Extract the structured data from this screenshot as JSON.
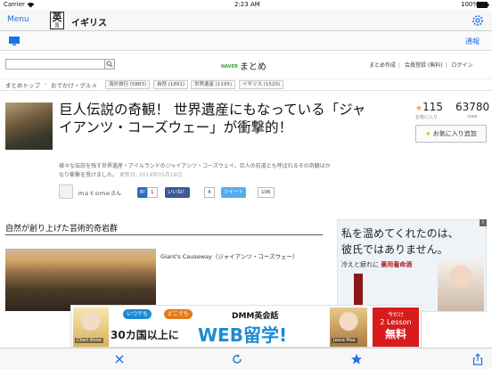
{
  "status_bar": {
    "carrier": "Carrier",
    "wifi_icon": "wifi-icon",
    "time": "2:23 AM",
    "battery": "100%",
    "battery_icon": "battery-icon"
  },
  "nav": {
    "menu_label": "Menu",
    "dict_big": "英",
    "dict_small": "国",
    "title": "イギリス",
    "settings_icon": "gear-icon"
  },
  "toolbar": {
    "monitor_icon": "monitor-icon",
    "notify_label": "通報"
  },
  "site": {
    "search_icon": "search-icon",
    "logo_naver": "NAVER",
    "logo_text": "まとめ",
    "links": [
      "まとめ作成",
      "会員登録 (無料)",
      "ログイン"
    ]
  },
  "breadcrumb": {
    "items": [
      "まとめトップ",
      "おでかけ・グルメ"
    ],
    "tags": [
      "海外旅行 (5883)",
      "自然 (1891)",
      "世界遺産 (1195)",
      "イギリス (1520)"
    ]
  },
  "article": {
    "title": "巨人伝説の奇観！ 世界遺産にもなっている「ジャイアンツ・コーズウェー」が衝撃的！",
    "favorite_count": "115",
    "favorite_label": "お気に入り",
    "view_count": "63780",
    "view_label": "view",
    "favorite_button": "お気に入り追加",
    "description": "様々な伝説を残す世界遺産・アイルランドのジャイアンツ・コーズウェイ。巨人の石道とも呼ばれるその奇観はかなり衝撃を受けました。",
    "date": "更新日: 2014年05月18日",
    "author": "ｍａｔｏｍｅさん",
    "social": {
      "hatena_label": "B!",
      "hatena_count": "1",
      "like_label": "いいね！",
      "like_count": "4",
      "tweet_label": "ツイート",
      "tweet_count": "106"
    }
  },
  "section": {
    "title": "自然が創り上げた芸術的奇岩群",
    "caption": "Giant's Causeway（ジャイアンツ・コーズウェー）"
  },
  "side_ad": {
    "line1": "私を温めてくれたのは、",
    "line2": "彼氏ではありません。",
    "line3": "冷えと疲れに",
    "brand": "薬用養命酒",
    "info": "i"
  },
  "banner": {
    "pill1": "いつでも",
    "pill2": "どこでも",
    "brand": "DMM英会話",
    "main1": "30カ国以上に",
    "main2": "WEB留学!",
    "name1": "Cheri Anne",
    "name2": "Jessa Mae",
    "red_a": "今だけ",
    "red_b": "2 Lesson",
    "red_c": "無料"
  },
  "bottom_toolbar": {
    "close_icon": "close-icon",
    "reload_icon": "reload-icon",
    "star_icon": "star-icon",
    "share_icon": "share-icon"
  }
}
